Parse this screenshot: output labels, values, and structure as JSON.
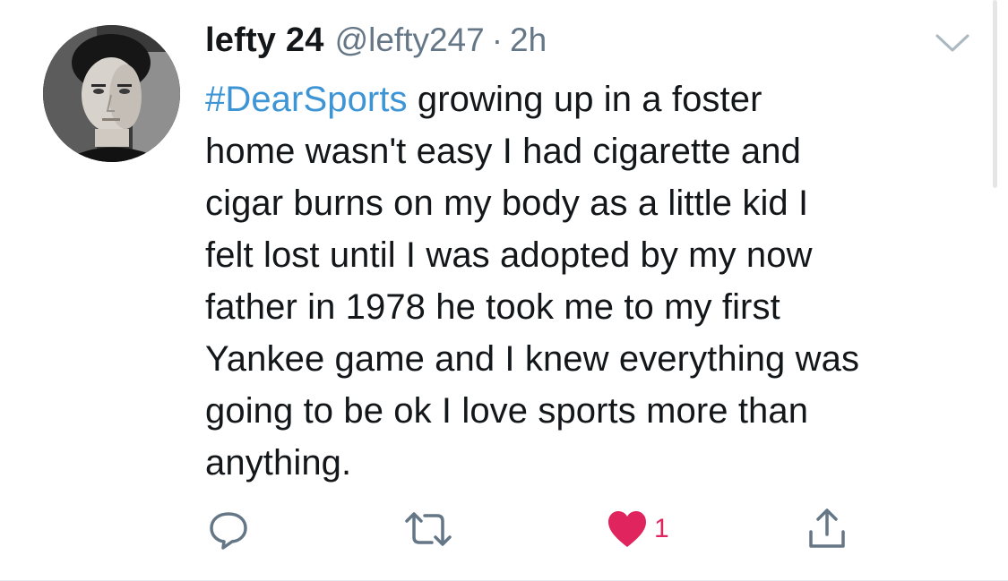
{
  "tweet": {
    "author_name": "lefty 24",
    "author_handle": "@lefty247",
    "separator": "·",
    "timestamp": "2h",
    "hashtag": "#DearSports",
    "body_lines": [
      " growing up in a foster",
      "home wasn't easy I had cigarette and",
      "cigar burns on my body as a little kid I",
      "felt lost until I was adopted by my now",
      "father in 1978 he took me to my first",
      "Yankee game and I knew everything was",
      "going to be ok I love sports more than",
      "anything."
    ]
  },
  "actions": {
    "reply_icon": "reply-icon",
    "retweet_icon": "retweet-icon",
    "like_icon": "heart-icon",
    "like_count": "1",
    "share_icon": "share-icon"
  },
  "colors": {
    "hashtag": "#3e95d5",
    "like_active": "#e0245e",
    "secondary_text": "#657786",
    "icon_gray": "#657786"
  }
}
